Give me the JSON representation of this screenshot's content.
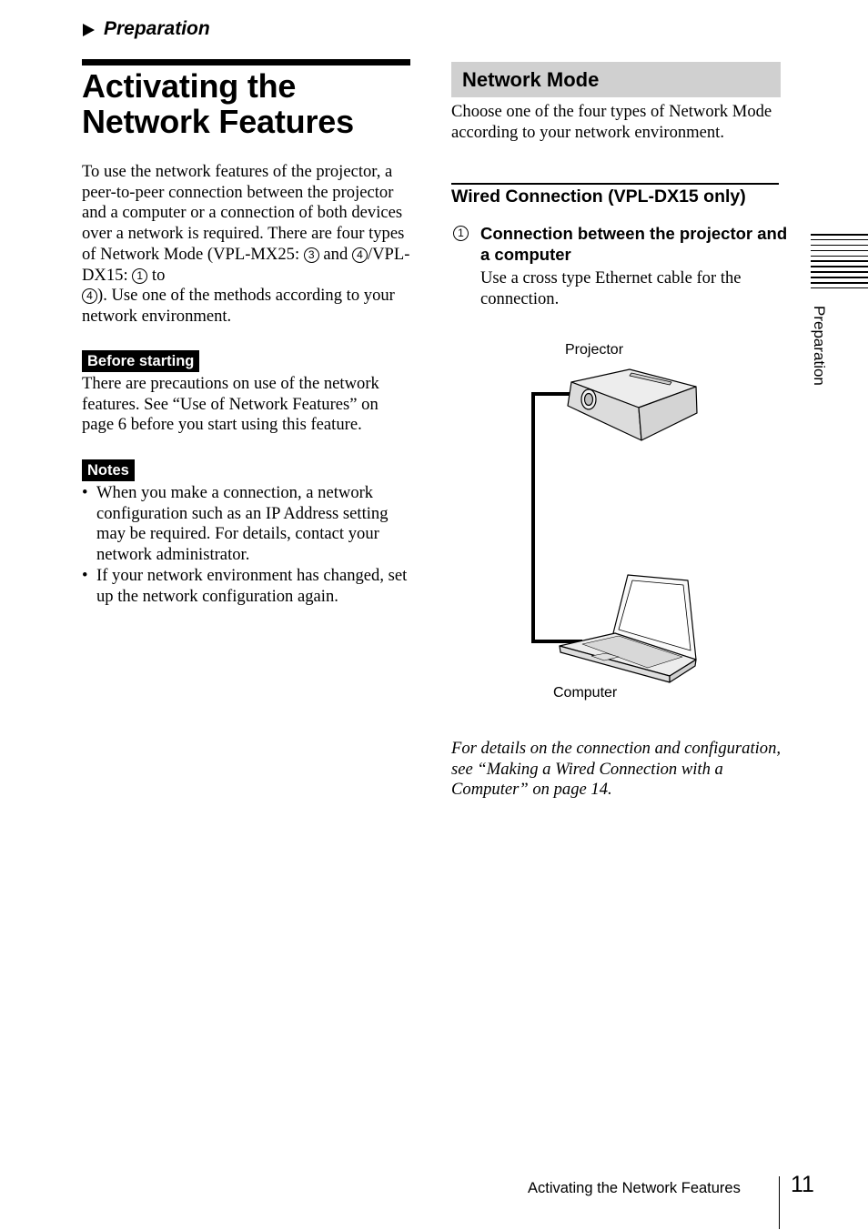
{
  "header": {
    "section_crumb": "Preparation"
  },
  "page_title": {
    "line1": "Activating the",
    "line2": "Network Features"
  },
  "intro": {
    "part1": "To use the network features of the projector, a peer-to-peer connection between the projector and a computer or a connection of both devices over a network is required. There are four types of Network Mode (VPL-MX25: ",
    "circ_a": "3",
    "part2": " and ",
    "circ_b": "4",
    "part3": "/VPL-DX15: ",
    "circ_c": "1",
    "part4": " to ",
    "circ_d": "4",
    "part5": "). Use one of the methods according to your network environment."
  },
  "before_starting": {
    "label": "Before starting",
    "text": "There are precautions on use of the network features. See “Use of Network Features” on page 6 before you start using this feature."
  },
  "notes": {
    "label": "Notes",
    "items": [
      "When you make a connection, a network configuration such as an IP Address setting may be required. For details, contact your network administrator.",
      "If your network environment has changed, set up the network configuration again."
    ],
    "bullet": "•"
  },
  "network_mode": {
    "heading": "Network Mode",
    "text": "Choose one of the four types of Network Mode according to your network environment."
  },
  "wired": {
    "heading": "Wired Connection (VPL-DX15 only)",
    "item_number": "1",
    "item_heading": "Connection between the projector and a computer",
    "item_text": "Use a cross type Ethernet cable for the connection."
  },
  "diagram": {
    "projector_label": "Projector",
    "computer_label": "Computer",
    "icons": [
      "projector-icon",
      "laptop-icon",
      "ethernet-cable"
    ]
  },
  "reference": {
    "text": "For details on the connection and configuration, see “Making a Wired Connection with a Computer” on page 14."
  },
  "side_tab": {
    "label": "Preparation"
  },
  "footer": {
    "title": "Activating the Network Features",
    "page_number": "11"
  }
}
